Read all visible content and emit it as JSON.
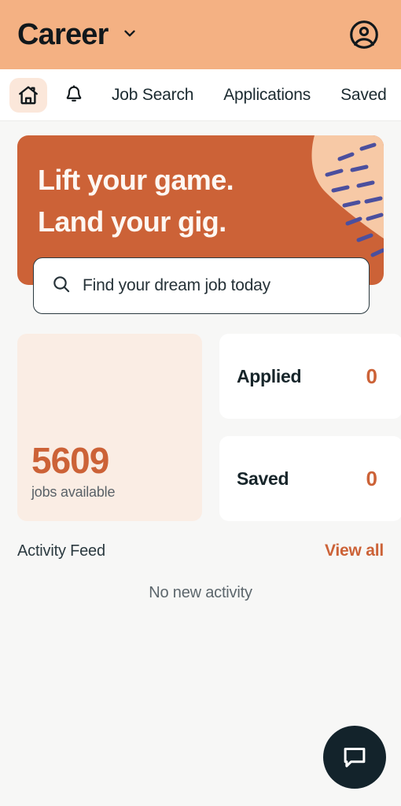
{
  "header": {
    "brand_title": "Career",
    "dropdown_icon": "chevron-down-icon",
    "account_icon": "account-circle-icon"
  },
  "nav": {
    "home_icon": "home-icon",
    "bell_icon": "bell-icon",
    "tabs": [
      {
        "label": "Job Search"
      },
      {
        "label": "Applications"
      },
      {
        "label": "Saved"
      }
    ]
  },
  "hero": {
    "line1": "Lift your game.",
    "line2": "Land your gig.",
    "background_color": "#cc6237",
    "decoration_color": "#f7c9a6",
    "decoration_dash_color": "#4b4f9e"
  },
  "search": {
    "icon": "search-icon",
    "placeholder": "Find your dream job today",
    "value": ""
  },
  "stats": {
    "jobs": {
      "count": "5609",
      "label": "jobs available",
      "accent_color": "#cc6237",
      "background_color": "#faede4"
    },
    "cards": [
      {
        "label": "Applied",
        "value": "0"
      },
      {
        "label": "Saved",
        "value": "0"
      }
    ]
  },
  "activity": {
    "title": "Activity Feed",
    "view_all_label": "View all",
    "empty_text": "No new activity",
    "link_color": "#cc6237"
  },
  "fab": {
    "icon": "chat-bubble-icon",
    "background_color": "#13232b"
  }
}
